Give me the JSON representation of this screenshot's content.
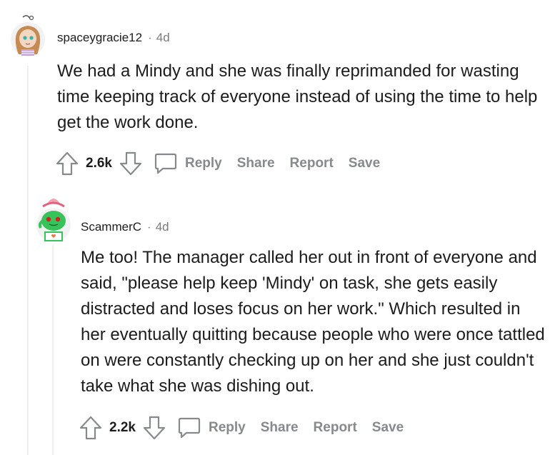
{
  "comments": [
    {
      "username": "spaceygracie12",
      "separator": "·",
      "age": "4d",
      "text": "We had a Mindy and she was finally reprimanded for wasting time keeping track of everyone instead of using the time to help get the work done.",
      "score": "2.6k",
      "actions": {
        "reply": "Reply",
        "share": "Share",
        "report": "Report",
        "save": "Save"
      }
    },
    {
      "username": "ScammerC",
      "separator": "·",
      "age": "4d",
      "text": "Me too! The manager called her out in front of everyone and said, \"please help keep 'Mindy' on task, she gets easily distracted and loses focus on her work.\" Which resulted in her eventually quitting because people who were once tattled on were constantly checking up on her and she just couldn't take what she was dishing out.",
      "score": "2.2k",
      "actions": {
        "reply": "Reply",
        "share": "Share",
        "report": "Report",
        "save": "Save"
      }
    }
  ],
  "colors": {
    "text": "#1c1c1c",
    "muted": "#7c7c7c",
    "action": "#878a8c",
    "thread_line": "#edeff1"
  }
}
